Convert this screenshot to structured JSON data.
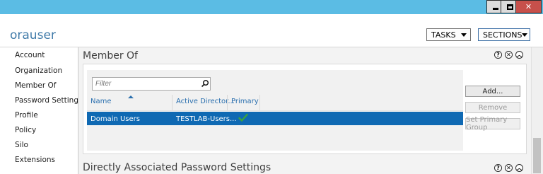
{
  "window": {
    "minimize_icon": "minimize-icon",
    "maximize_icon": "maximize-icon",
    "close_label": "✕"
  },
  "header": {
    "title": "orauser",
    "tasks_label": "TASKS",
    "sections_label": "SECTIONS"
  },
  "nav": {
    "items": [
      {
        "label": "Account"
      },
      {
        "label": "Organization"
      },
      {
        "label": "Member Of"
      },
      {
        "label": "Password Settings"
      },
      {
        "label": "Profile"
      },
      {
        "label": "Policy"
      },
      {
        "label": "Silo"
      },
      {
        "label": "Extensions"
      }
    ]
  },
  "member_of": {
    "title": "Member Of",
    "filter_placeholder": "Filter",
    "columns": [
      "Name",
      "Active Director...",
      "Primary"
    ],
    "rows": [
      {
        "name": "Domain Users",
        "path": "TESTLAB-Users...",
        "primary": true
      }
    ],
    "buttons": {
      "add": "Add...",
      "remove": "Remove",
      "set_primary": "Set Primary Group"
    }
  },
  "password_settings": {
    "title": "Directly Associated Password Settings"
  },
  "section_icons": {
    "help": "?",
    "close": "✕",
    "collapse": "︿"
  },
  "colors": {
    "titlebar": "#5bbce4",
    "app_title": "#3f7aa8",
    "selection": "#0f69b3",
    "column_header": "#2a6fae",
    "check": "#3ca43c"
  }
}
